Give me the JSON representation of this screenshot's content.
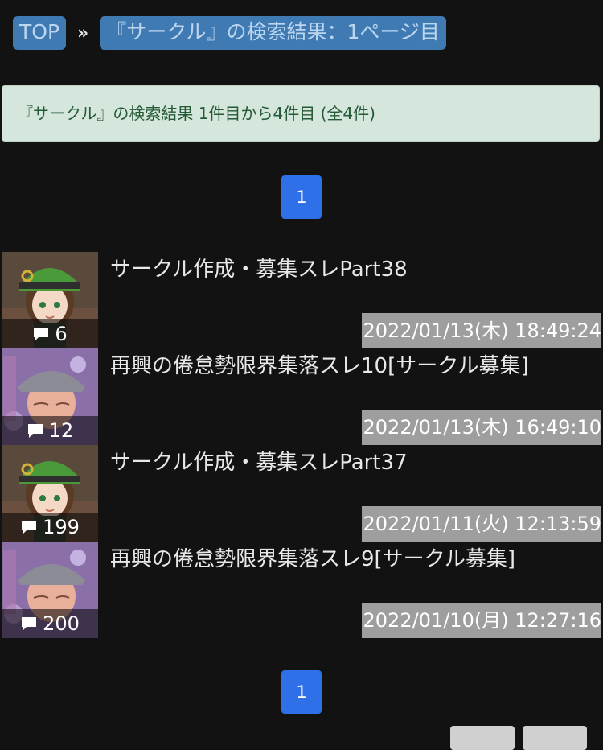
{
  "breadcrumb": {
    "top_label": "TOP",
    "separator": "»",
    "current_label": "『サークル』の検索結果：1ページ目"
  },
  "result_summary": "『サークル』の検索結果 1件目から4件目 (全4件)",
  "pagination": {
    "current_page": "1"
  },
  "threads": [
    {
      "title": "サークル作成・募集スレPart38",
      "count": "6",
      "date": "2022/01/13(木) 18:49:24",
      "thumb_icon": "green-hat-girl-avatar"
    },
    {
      "title": "再興の倦怠勢限界集落スレ10[サークル募集]",
      "count": "12",
      "date": "2022/01/13(木) 16:49:10",
      "thumb_icon": "grey-hat-girl-avatar"
    },
    {
      "title": "サークル作成・募集スレPart37",
      "count": "199",
      "date": "2022/01/11(火) 12:13:59",
      "thumb_icon": "green-hat-girl-avatar"
    },
    {
      "title": "再興の倦怠勢限界集落スレ9[サークル募集]",
      "count": "200",
      "date": "2022/01/10(月) 12:27:16",
      "thumb_icon": "grey-hat-girl-avatar"
    }
  ],
  "colors": {
    "background": "#121212",
    "breadcrumb_bg": "#3f7ab3",
    "summary_bg": "#d5e6dc",
    "summary_text": "#245a35",
    "pager_bg": "#2f6fe8",
    "date_bg": "#9e9e9e"
  }
}
